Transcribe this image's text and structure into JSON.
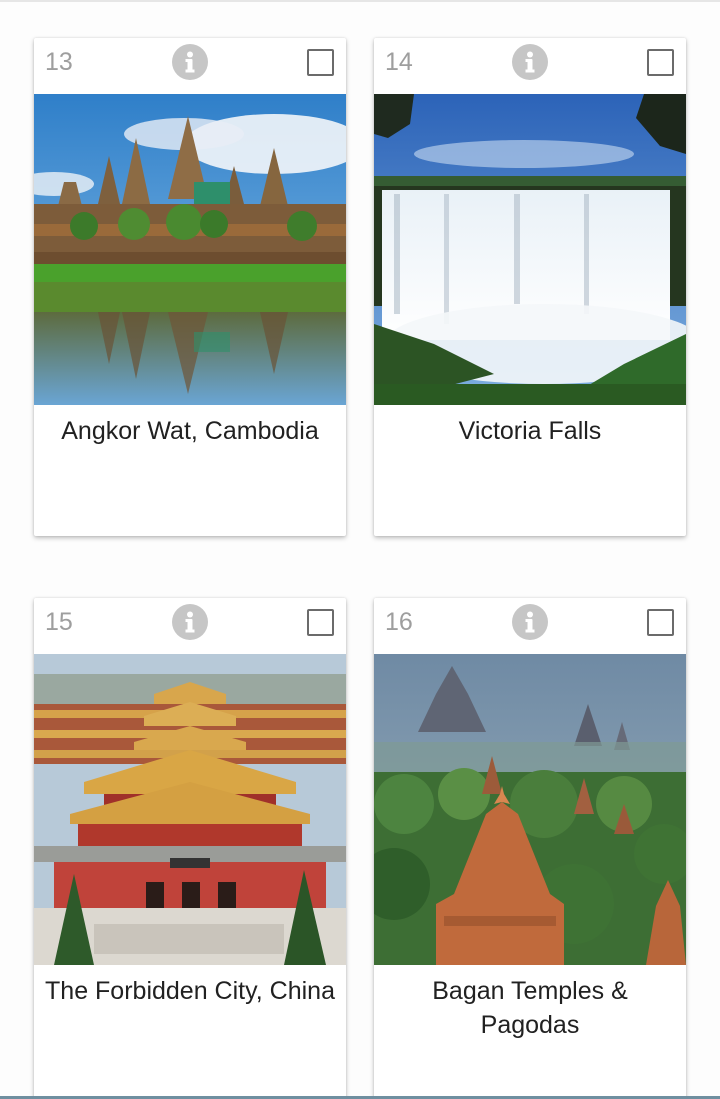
{
  "cards": [
    {
      "number": "13",
      "title": "Angkor Wat, Cambodia",
      "info_icon": "info-icon",
      "image": "angkor-wat-photo"
    },
    {
      "number": "14",
      "title": "Victoria Falls",
      "info_icon": "info-icon",
      "image": "victoria-falls-photo"
    },
    {
      "number": "15",
      "title": "The Forbidden City, China",
      "info_icon": "info-icon",
      "image": "forbidden-city-photo"
    },
    {
      "number": "16",
      "title": "Bagan Temples & Pagodas",
      "info_icon": "info-icon",
      "image": "bagan-temples-photo"
    }
  ],
  "colors": {
    "number_text": "#9e9e9e",
    "info_icon_bg": "#c6c6c6",
    "title_text": "#212121",
    "checkbox_border": "#6b6b6b"
  }
}
